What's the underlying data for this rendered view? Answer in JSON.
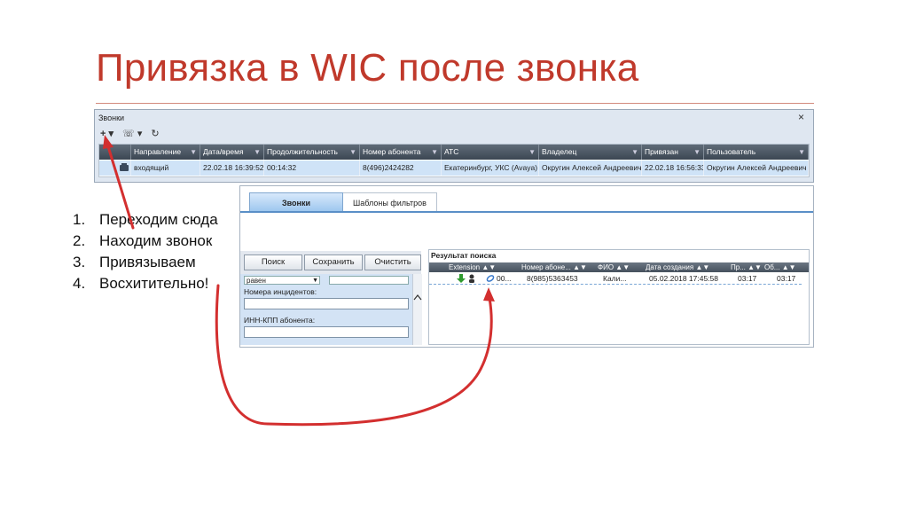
{
  "slide": {
    "title": "Привязка в WIC после звонка",
    "steps": [
      {
        "num": "1.",
        "text": "Переходим сюда"
      },
      {
        "num": "2.",
        "text": "Находим звонок"
      },
      {
        "num": "3.",
        "text": "Привязываем"
      },
      {
        "num": "4.",
        "text": "Восхитительно!"
      }
    ]
  },
  "calls_window": {
    "title": "Звонки",
    "close": "×",
    "toolbar": {
      "add": "+ ▾",
      "call": "☏ ▾",
      "refresh": "↻"
    },
    "columns": [
      "Направление",
      "Дата/время",
      "Продолжительность",
      "Номер абонента",
      "АТС",
      "Владелец",
      "Привязан",
      "Пользователь"
    ],
    "filter_glyph": "▼",
    "row": [
      "входящий",
      "22.02.18 16:39:52",
      "00:14:32",
      "8(496)2424282",
      "Екатеринбург, УКС (Avaya)",
      "Округин Алексей Андреевич",
      "22.02.18 16:56:33",
      "Округин Алексей Андреевич"
    ],
    "row_icon": "phone-in-icon"
  },
  "search_window": {
    "tabs": [
      "Звонки",
      "Шаблоны фильтров"
    ],
    "buttons": {
      "search": "Поиск",
      "save": "Сохранить",
      "clear": "Очистить"
    },
    "filter": {
      "combo_value": "равен",
      "incident_label": "Номера инцидентов:",
      "inn_label": "ИНН-КПП абонента:"
    },
    "results": {
      "title": "Результат поиска",
      "columns": [
        "Extension",
        "Номер абоне...",
        "ФИО",
        "Дата создания",
        "Пр...",
        "Об..."
      ],
      "sort_glyph": "▲▼",
      "row": [
        "00...",
        "8(985)5363453",
        "Кали...",
        "05.02.2018 17:45:58",
        "03:17",
        "03:17"
      ]
    }
  },
  "colors": {
    "title": "#c0392b",
    "annotation_arrow": "#d32f2f",
    "selection": "#cfe3f7"
  }
}
